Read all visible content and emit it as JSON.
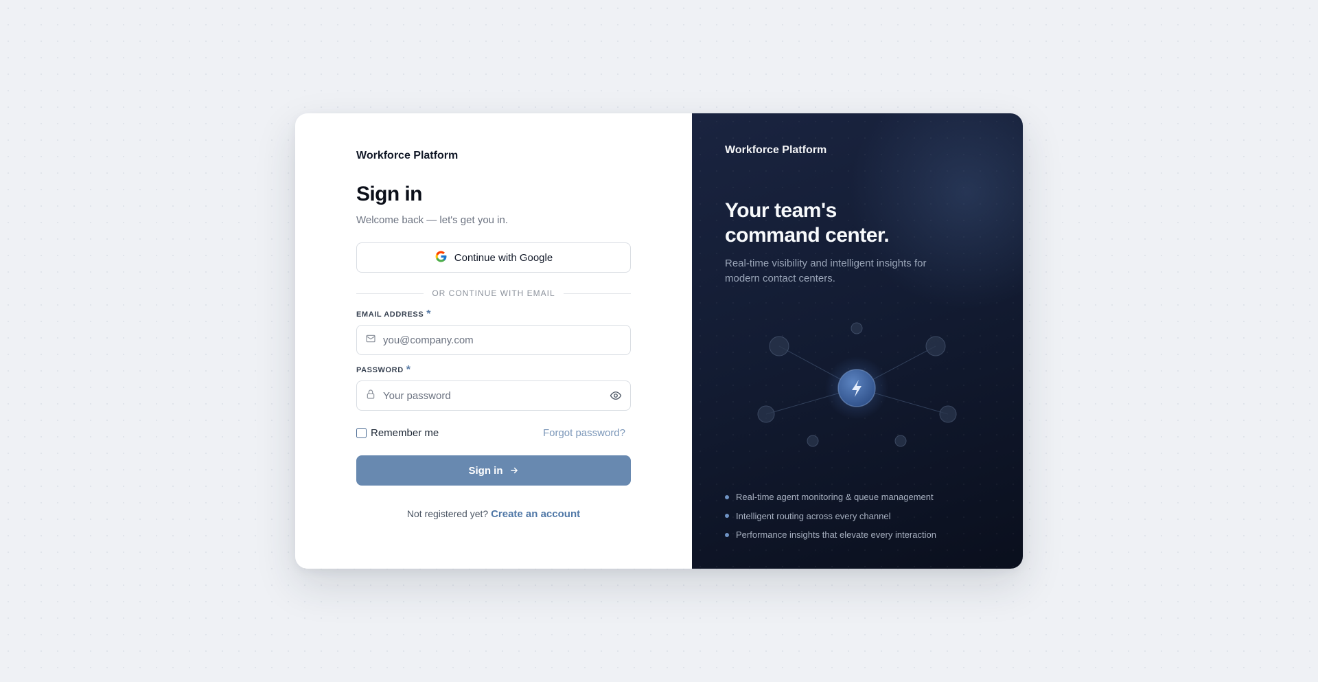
{
  "left": {
    "brand": "Workforce Platform",
    "heading": "Sign in",
    "subtitle": "Welcome back — let's get you in.",
    "google_button": "Continue with Google",
    "divider": "OR CONTINUE WITH EMAIL",
    "email_label": "EMAIL ADDRESS",
    "email_placeholder": "you@company.com",
    "password_label": "PASSWORD",
    "password_placeholder": "Your password",
    "required_mark": "*",
    "remember_me": "Remember me",
    "forgot_password": "Forgot password?",
    "signin_button": "Sign in",
    "not_registered": "Not registered yet?",
    "create_account": "Create an account"
  },
  "right": {
    "brand": "Workforce Platform",
    "title_line1": "Your team's",
    "title_line2": "command center.",
    "description": "Real-time visibility and intelligent insights for modern contact centers.",
    "features": [
      "Real-time agent monitoring & queue management",
      "Intelligent routing across every channel",
      "Performance insights that elevate every interaction"
    ]
  },
  "colors": {
    "accent": "#6889b0",
    "link": "#4f77a6",
    "panel_dark": "#131c33",
    "page_bg": "#eff1f5"
  },
  "icons": [
    "google-icon",
    "mail-icon",
    "lock-icon",
    "eye-icon",
    "arrow-right-icon",
    "bolt-icon"
  ]
}
